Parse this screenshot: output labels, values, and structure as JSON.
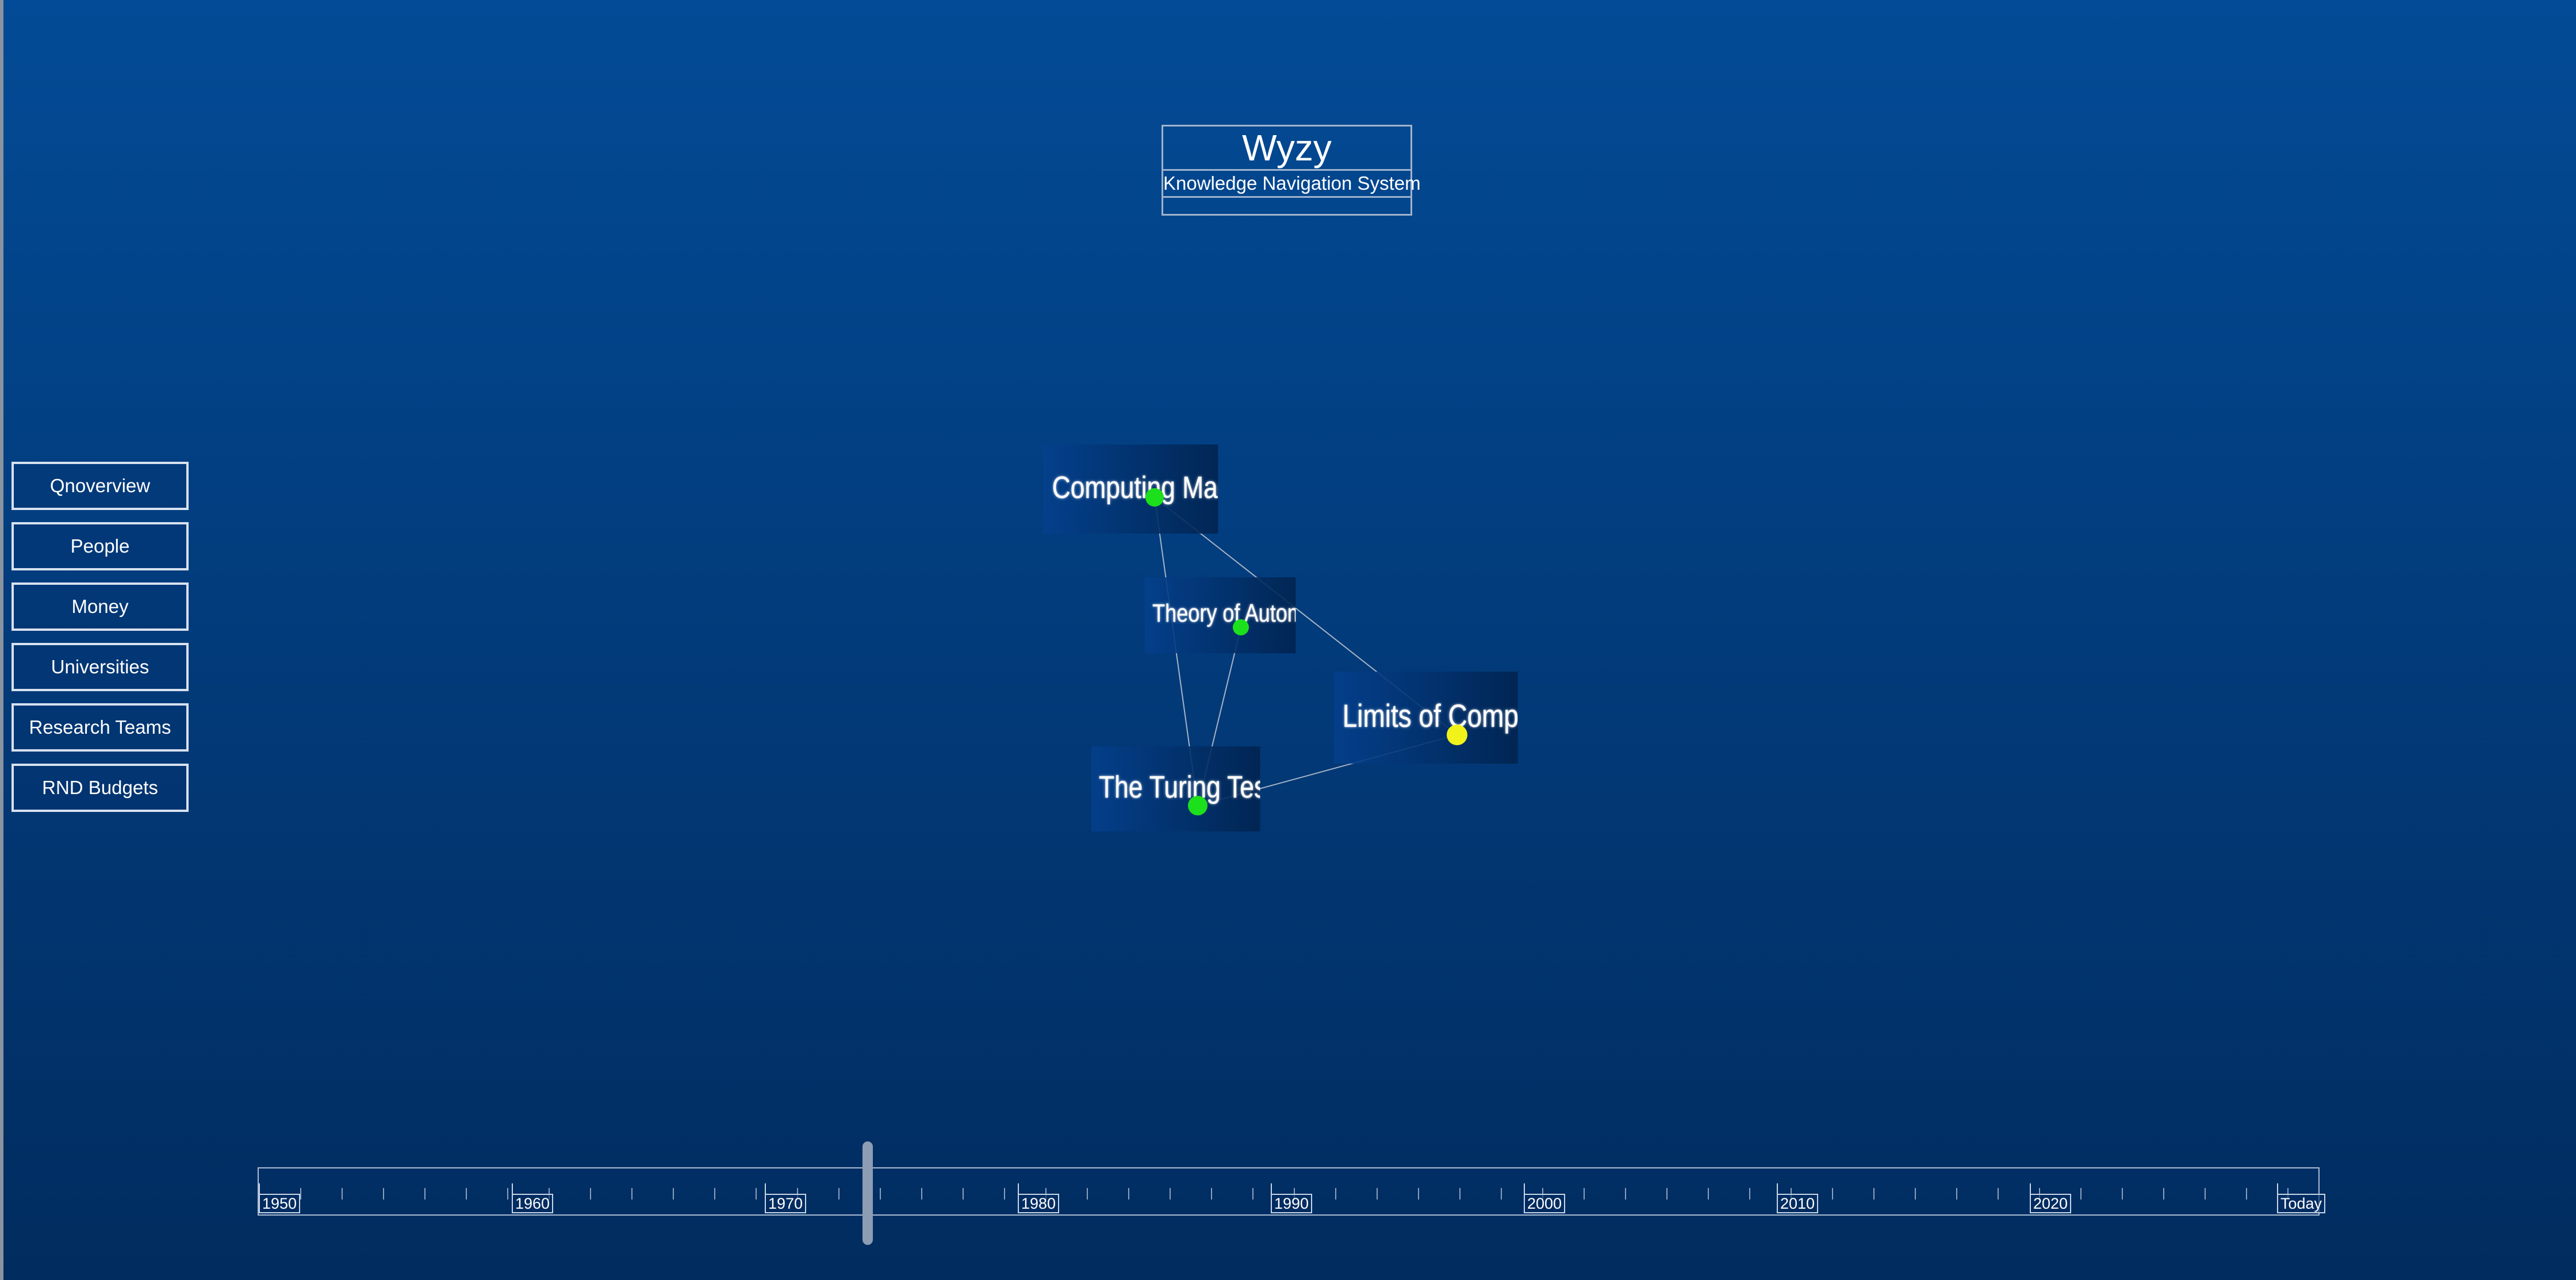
{
  "app": {
    "title": "Wyzy",
    "subtitle": "Knowledge Navigation System"
  },
  "menu": {
    "items": [
      {
        "label": "Qnoverview"
      },
      {
        "label": "People"
      },
      {
        "label": "Money"
      },
      {
        "label": "Universities"
      },
      {
        "label": "Research Teams"
      },
      {
        "label": "RND Budgets"
      }
    ]
  },
  "graph": {
    "nodes": [
      {
        "label": "Computing Machinery",
        "dot_color": "#1de01d"
      },
      {
        "label": "Theory of Automata",
        "dot_color": "#1de01d"
      },
      {
        "label": "Limits of Computation",
        "dot_color": "#f2f21b"
      },
      {
        "label": "The Turing Test",
        "dot_color": "#1de01d"
      }
    ],
    "edge_color": "#a7b4c6"
  },
  "timeline": {
    "labels": [
      "1950",
      "1960",
      "1970",
      "1980",
      "1990",
      "2000",
      "2010",
      "2020",
      "Today"
    ]
  }
}
